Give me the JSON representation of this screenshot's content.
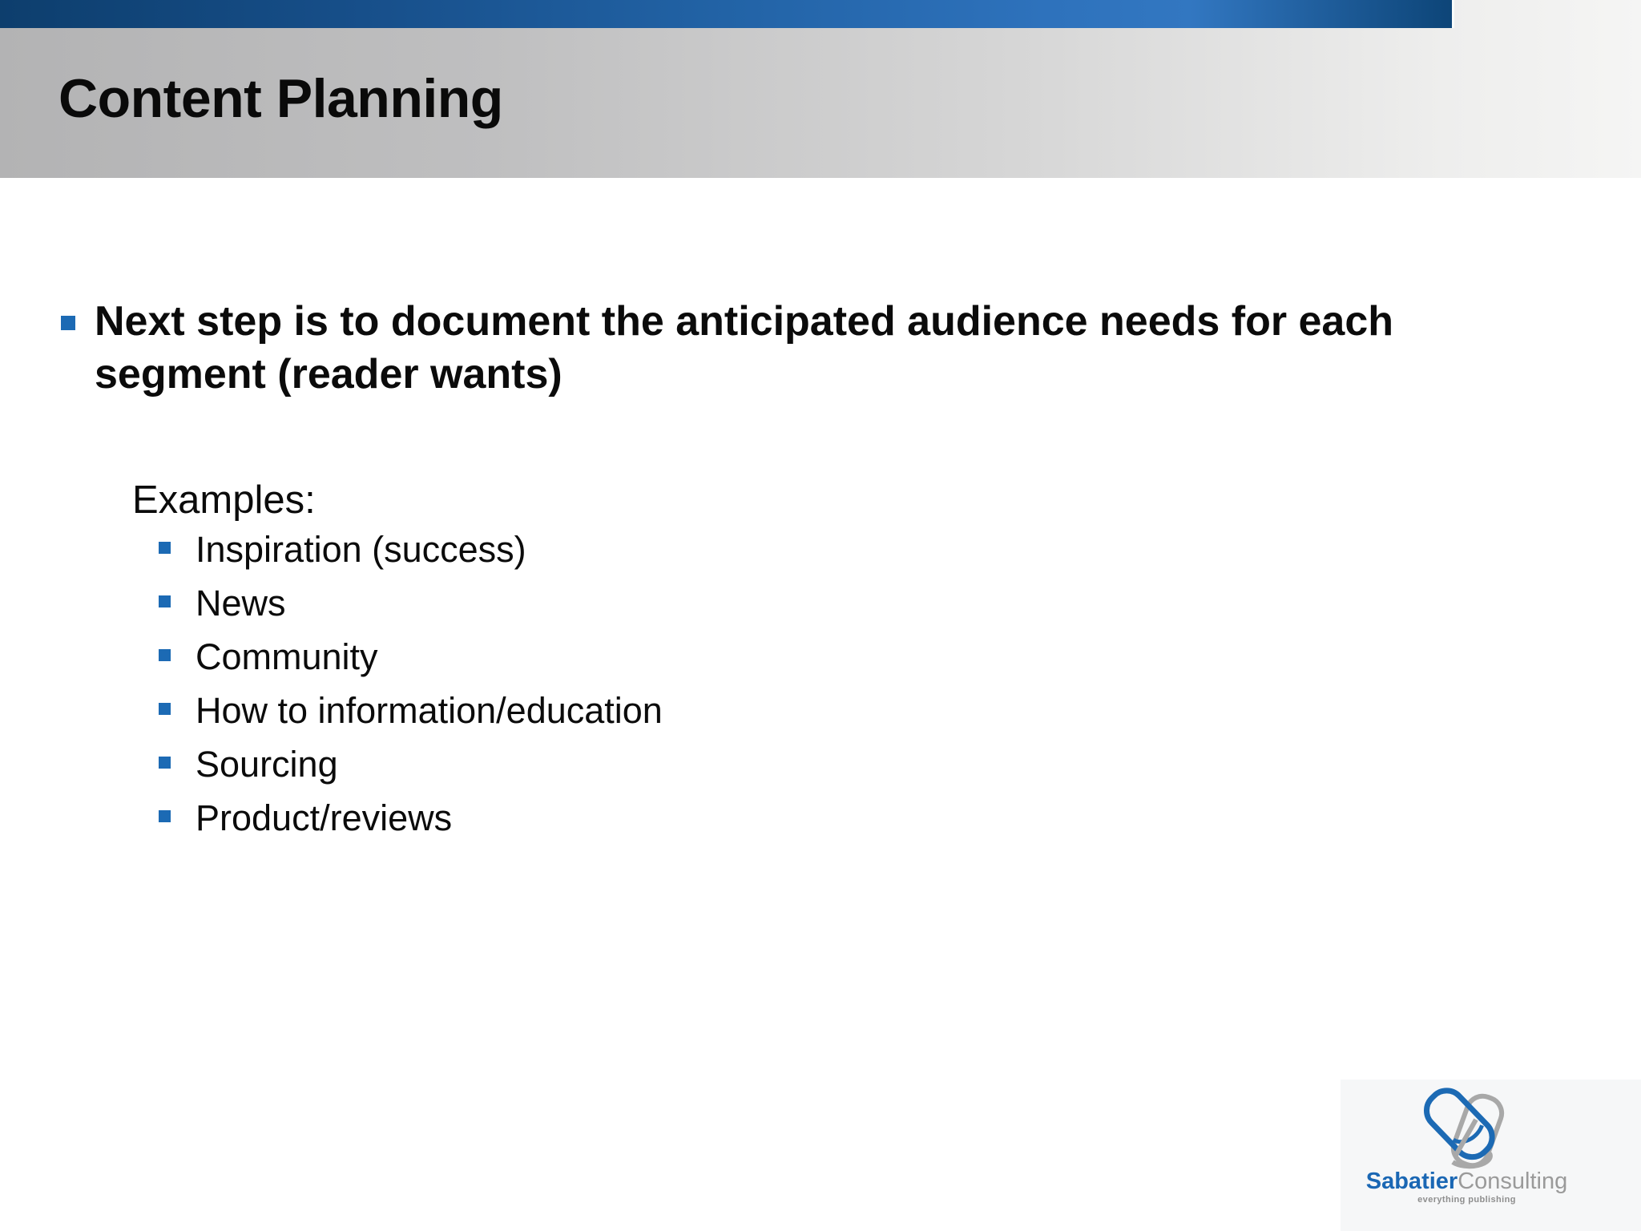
{
  "slide": {
    "header": {
      "title": "Content Planning"
    },
    "content": {
      "main_bullet": "Next step is to document the anticipated audience needs for each segment (reader wants)",
      "examples_label": "Examples:",
      "example_items": [
        "Inspiration (success)",
        "News",
        "Community",
        "How to information/education",
        "Sourcing",
        "Product/reviews"
      ]
    },
    "logo": {
      "brand_bold": "Sabatier",
      "brand_light": "Consulting",
      "tagline": "everything publishing"
    },
    "colors": {
      "accent_blue": "#1c6ab4",
      "top_bar_dark": "#0d3e6d",
      "top_bar_bright": "#2e72bc",
      "top_bar_end": "#0d4578",
      "header_gray_left": "#b3b3b4",
      "header_gray_right": "#f5f5f4",
      "logo_blue": "#1a67b4",
      "logo_gray": "#9a9a9a"
    }
  }
}
